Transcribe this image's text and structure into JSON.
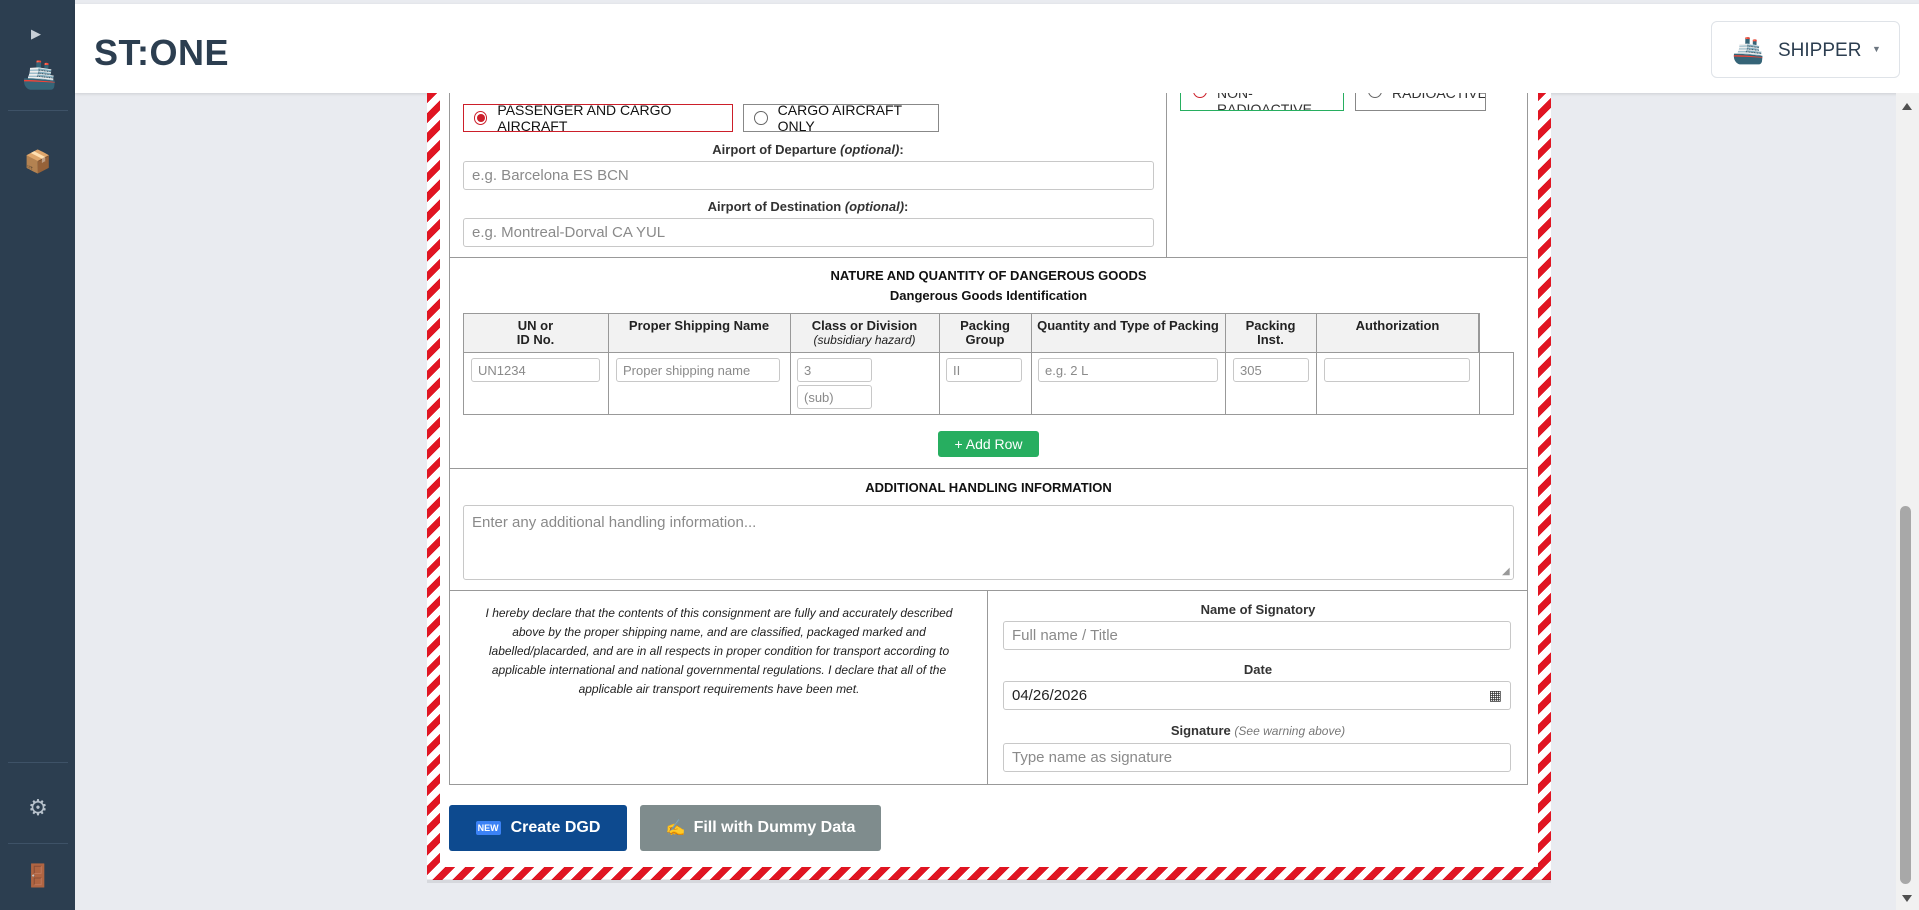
{
  "app": {
    "title": "ST:ONE"
  },
  "sidebar": {
    "toggle_icon": "play-icon",
    "logo_icon": "ship-icon",
    "items": [
      {
        "icon": "package-icon",
        "glyph": "📦"
      },
      {
        "icon": "gear-icon",
        "glyph": "⚙"
      },
      {
        "icon": "door-icon",
        "glyph": "🚪"
      }
    ]
  },
  "header": {
    "role_label": "SHIPPER",
    "role_icon": "ship-icon"
  },
  "aircraft": {
    "option_passenger": "PASSENGER AND CARGO AIRCRAFT",
    "option_cargo": "CARGO AIRCRAFT ONLY",
    "selected": "PASSENGER AND CARGO AIRCRAFT"
  },
  "shipment_type": {
    "option_non_radioactive": "NON-RADIOACTIVE",
    "option_radioactive": "RADIOACTIVE",
    "selected": "NON-RADIOACTIVE"
  },
  "airports": {
    "departure_label": "Airport of Departure",
    "departure_optional": "(optional)",
    "departure_placeholder": "e.g. Barcelona ES BCN",
    "destination_label": "Airport of Destination",
    "destination_optional": "(optional)",
    "destination_placeholder": "e.g. Montreal-Dorval CA YUL"
  },
  "goods": {
    "title": "NATURE AND QUANTITY OF DANGEROUS GOODS",
    "subtitle": "Dangerous Goods Identification",
    "columns": {
      "un_line1": "UN or",
      "un_line2": "ID No.",
      "psn": "Proper Shipping Name",
      "class": "Class or Division",
      "class_sub": "(subsidiary hazard)",
      "pg_line1": "Packing",
      "pg_line2": "Group",
      "qty": "Quantity and Type of Packing",
      "pi_line1": "Packing",
      "pi_line2": "Inst.",
      "auth": "Authorization"
    },
    "row_placeholders": {
      "un": "UN1234",
      "psn": "Proper shipping name",
      "class": "3",
      "sub": "(sub)",
      "pg": "II",
      "qty": "e.g. 2 L",
      "pi": "305",
      "auth": ""
    },
    "add_row_label": "+ Add Row"
  },
  "handling": {
    "title": "ADDITIONAL HANDLING INFORMATION",
    "placeholder": "Enter any additional handling information..."
  },
  "declaration": {
    "text": "I hereby declare that the contents of this consignment are fully and accurately described above by the proper shipping name, and are classified, packaged marked and labelled/placarded, and are in all respects in proper condition for transport according to applicable international and national governmental regulations. I declare that all of the applicable air transport requirements have been met."
  },
  "signatory": {
    "name_label": "Name of Signatory",
    "name_placeholder": "Full name / Title",
    "date_label": "Date",
    "date_value": "04/26/2026",
    "signature_label": "Signature",
    "signature_note": "(See warning above)",
    "signature_placeholder": "Type name as signature"
  },
  "actions": {
    "create_icon": "🆕",
    "create_label": "Create DGD",
    "dummy_icon": "✍",
    "dummy_label": "Fill with Dummy Data"
  },
  "colors": {
    "sidebar_bg": "#2c3e50",
    "hazard_red": "#e01522",
    "add_row_green": "#27ae60",
    "create_blue": "#0d4a8f",
    "dummy_gray": "#7f8c8d"
  }
}
